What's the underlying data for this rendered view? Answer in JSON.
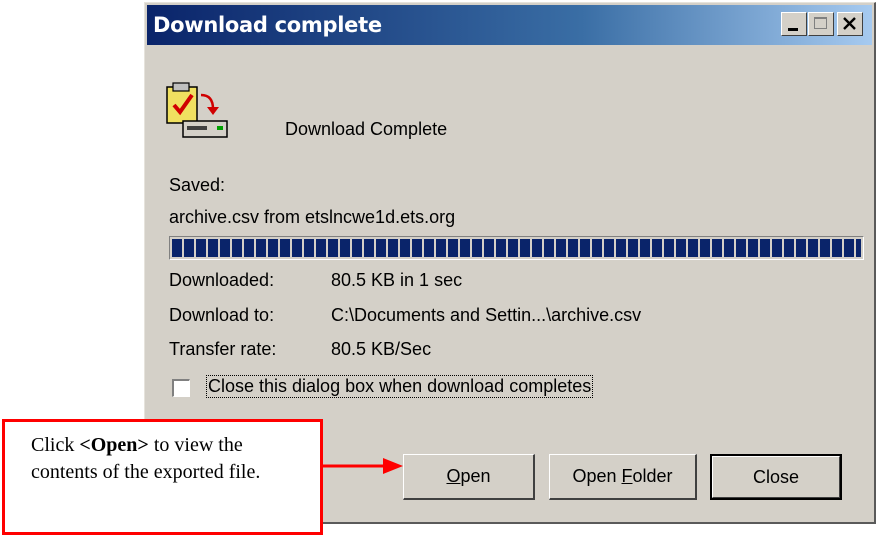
{
  "window": {
    "title": "Download complete",
    "heading": "Download Complete"
  },
  "titlebar_buttons": {
    "minimize": "minimize-icon",
    "maximize": "maximize-icon",
    "close": "close-icon"
  },
  "saved": {
    "label": "Saved:",
    "source": "archive.csv from etslncwe1d.ets.org"
  },
  "progress": {
    "percent": 100
  },
  "details": {
    "downloaded_label": "Downloaded:",
    "downloaded_value": "80.5 KB in 1 sec",
    "download_to_label": "Download to:",
    "download_to_value": "C:\\Documents and Settin...\\archive.csv",
    "transfer_rate_label": "Transfer rate:",
    "transfer_rate_value": "80.5 KB/Sec"
  },
  "checkbox": {
    "label": "Close this dialog box when download completes",
    "checked": false
  },
  "buttons": {
    "open_first": "O",
    "open_rest": "pen",
    "folder_pre": "Open ",
    "folder_key": "F",
    "folder_rest": "older",
    "close": "Close"
  },
  "callout": {
    "pre": "Click ",
    "bold": "<Open>",
    "post": " to view the contents of the exported file."
  },
  "colors": {
    "titlebar": "#0a246a",
    "face": "#d4d0c8",
    "progress": "#0a246a",
    "callout_border": "#ff0000"
  }
}
